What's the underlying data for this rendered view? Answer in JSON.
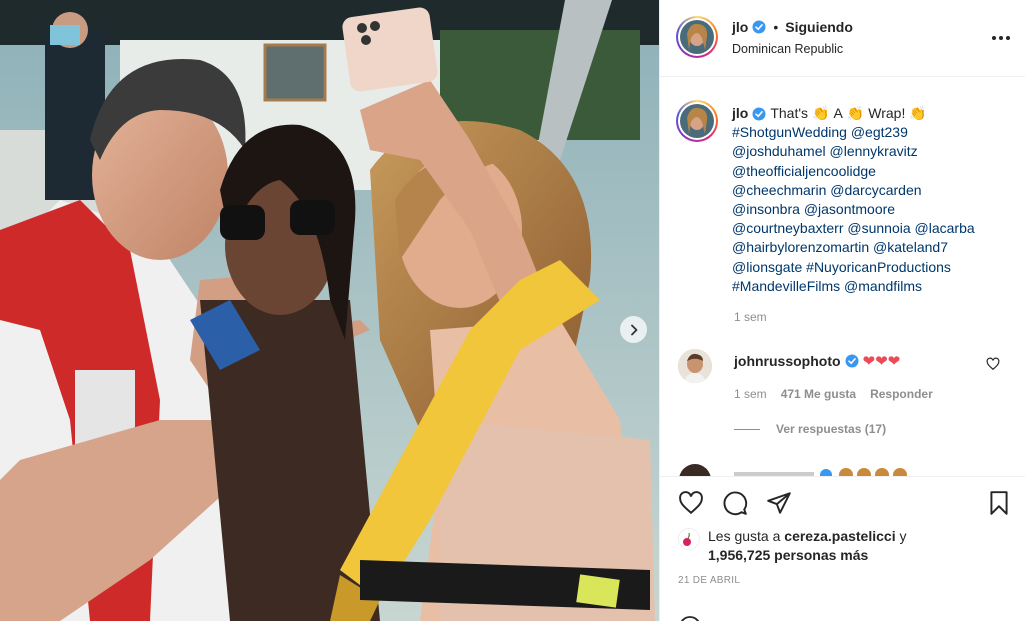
{
  "post": {
    "header": {
      "username": "jlo",
      "separator": "•",
      "follow_status": "Siguiendo",
      "location": "Dominican Republic",
      "more_icon": "more-horizontal-icon"
    },
    "caption": {
      "username": "jlo",
      "text_part1": "That's",
      "text_part2": "A",
      "text_part3": "Wrap!",
      "clap_emoji": "👏",
      "tags": [
        "#ShotgunWedding",
        "@egt239",
        "@joshduhamel",
        "@lennykravitz",
        "@theofficialjencoolidge",
        "@cheechmarin",
        "@darcycarden",
        "@insonbra",
        "@jasontmoore",
        "@courtneybaxterr",
        "@sunnoia",
        "@lacarba",
        "@hairbylorenzomartin",
        "@kateland7",
        "@lionsgate",
        "#NuyoricanProductions",
        "#MandevilleFilms",
        "@mandfilms"
      ],
      "time": "1 sem"
    },
    "comment": {
      "username": "johnrussophoto",
      "text": "❤❤❤",
      "time": "1 sem",
      "likes": "471 Me gusta",
      "reply": "Responder",
      "view_replies": "Ver respuestas (17)"
    },
    "likes": {
      "prefix": "Les gusta a",
      "liker": "cereza.pastelicci",
      "conjunction": "y",
      "others": "1,956,725 personas más"
    },
    "date": "21 DE ABRIL",
    "icons": {
      "like": "heart-icon",
      "comment": "comment-icon",
      "share": "send-icon",
      "save": "bookmark-icon",
      "carousel_next": "chevron-right-icon",
      "verified": "verified-badge-icon"
    },
    "colors": {
      "verified": "#3897f0",
      "link": "#00376b",
      "heart": "#ed4956",
      "muted": "#8e8e8e"
    }
  }
}
